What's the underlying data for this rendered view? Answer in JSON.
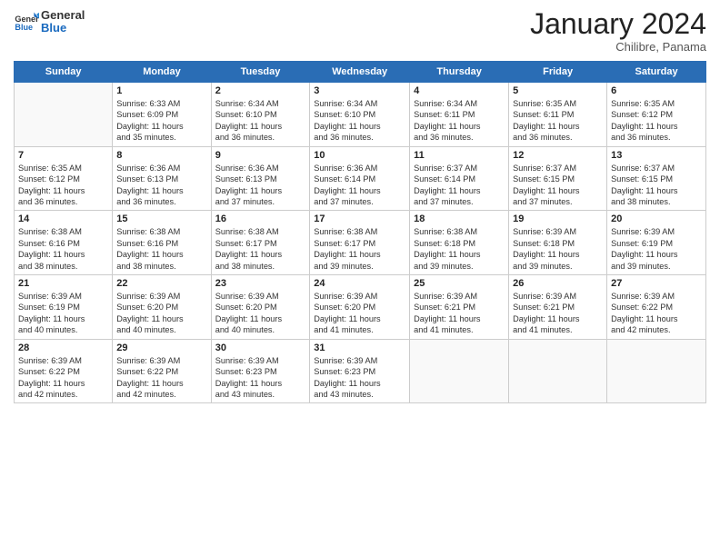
{
  "header": {
    "logo_general": "General",
    "logo_blue": "Blue",
    "month_title": "January 2024",
    "subtitle": "Chilibre, Panama"
  },
  "weekdays": [
    "Sunday",
    "Monday",
    "Tuesday",
    "Wednesday",
    "Thursday",
    "Friday",
    "Saturday"
  ],
  "weeks": [
    [
      {
        "day": "",
        "info": ""
      },
      {
        "day": "1",
        "info": "Sunrise: 6:33 AM\nSunset: 6:09 PM\nDaylight: 11 hours\nand 35 minutes."
      },
      {
        "day": "2",
        "info": "Sunrise: 6:34 AM\nSunset: 6:10 PM\nDaylight: 11 hours\nand 36 minutes."
      },
      {
        "day": "3",
        "info": "Sunrise: 6:34 AM\nSunset: 6:10 PM\nDaylight: 11 hours\nand 36 minutes."
      },
      {
        "day": "4",
        "info": "Sunrise: 6:34 AM\nSunset: 6:11 PM\nDaylight: 11 hours\nand 36 minutes."
      },
      {
        "day": "5",
        "info": "Sunrise: 6:35 AM\nSunset: 6:11 PM\nDaylight: 11 hours\nand 36 minutes."
      },
      {
        "day": "6",
        "info": "Sunrise: 6:35 AM\nSunset: 6:12 PM\nDaylight: 11 hours\nand 36 minutes."
      }
    ],
    [
      {
        "day": "7",
        "info": "Sunrise: 6:35 AM\nSunset: 6:12 PM\nDaylight: 11 hours\nand 36 minutes."
      },
      {
        "day": "8",
        "info": "Sunrise: 6:36 AM\nSunset: 6:13 PM\nDaylight: 11 hours\nand 36 minutes."
      },
      {
        "day": "9",
        "info": "Sunrise: 6:36 AM\nSunset: 6:13 PM\nDaylight: 11 hours\nand 37 minutes."
      },
      {
        "day": "10",
        "info": "Sunrise: 6:36 AM\nSunset: 6:14 PM\nDaylight: 11 hours\nand 37 minutes."
      },
      {
        "day": "11",
        "info": "Sunrise: 6:37 AM\nSunset: 6:14 PM\nDaylight: 11 hours\nand 37 minutes."
      },
      {
        "day": "12",
        "info": "Sunrise: 6:37 AM\nSunset: 6:15 PM\nDaylight: 11 hours\nand 37 minutes."
      },
      {
        "day": "13",
        "info": "Sunrise: 6:37 AM\nSunset: 6:15 PM\nDaylight: 11 hours\nand 38 minutes."
      }
    ],
    [
      {
        "day": "14",
        "info": "Sunrise: 6:38 AM\nSunset: 6:16 PM\nDaylight: 11 hours\nand 38 minutes."
      },
      {
        "day": "15",
        "info": "Sunrise: 6:38 AM\nSunset: 6:16 PM\nDaylight: 11 hours\nand 38 minutes."
      },
      {
        "day": "16",
        "info": "Sunrise: 6:38 AM\nSunset: 6:17 PM\nDaylight: 11 hours\nand 38 minutes."
      },
      {
        "day": "17",
        "info": "Sunrise: 6:38 AM\nSunset: 6:17 PM\nDaylight: 11 hours\nand 39 minutes."
      },
      {
        "day": "18",
        "info": "Sunrise: 6:38 AM\nSunset: 6:18 PM\nDaylight: 11 hours\nand 39 minutes."
      },
      {
        "day": "19",
        "info": "Sunrise: 6:39 AM\nSunset: 6:18 PM\nDaylight: 11 hours\nand 39 minutes."
      },
      {
        "day": "20",
        "info": "Sunrise: 6:39 AM\nSunset: 6:19 PM\nDaylight: 11 hours\nand 39 minutes."
      }
    ],
    [
      {
        "day": "21",
        "info": "Sunrise: 6:39 AM\nSunset: 6:19 PM\nDaylight: 11 hours\nand 40 minutes."
      },
      {
        "day": "22",
        "info": "Sunrise: 6:39 AM\nSunset: 6:20 PM\nDaylight: 11 hours\nand 40 minutes."
      },
      {
        "day": "23",
        "info": "Sunrise: 6:39 AM\nSunset: 6:20 PM\nDaylight: 11 hours\nand 40 minutes."
      },
      {
        "day": "24",
        "info": "Sunrise: 6:39 AM\nSunset: 6:20 PM\nDaylight: 11 hours\nand 41 minutes."
      },
      {
        "day": "25",
        "info": "Sunrise: 6:39 AM\nSunset: 6:21 PM\nDaylight: 11 hours\nand 41 minutes."
      },
      {
        "day": "26",
        "info": "Sunrise: 6:39 AM\nSunset: 6:21 PM\nDaylight: 11 hours\nand 41 minutes."
      },
      {
        "day": "27",
        "info": "Sunrise: 6:39 AM\nSunset: 6:22 PM\nDaylight: 11 hours\nand 42 minutes."
      }
    ],
    [
      {
        "day": "28",
        "info": "Sunrise: 6:39 AM\nSunset: 6:22 PM\nDaylight: 11 hours\nand 42 minutes."
      },
      {
        "day": "29",
        "info": "Sunrise: 6:39 AM\nSunset: 6:22 PM\nDaylight: 11 hours\nand 42 minutes."
      },
      {
        "day": "30",
        "info": "Sunrise: 6:39 AM\nSunset: 6:23 PM\nDaylight: 11 hours\nand 43 minutes."
      },
      {
        "day": "31",
        "info": "Sunrise: 6:39 AM\nSunset: 6:23 PM\nDaylight: 11 hours\nand 43 minutes."
      },
      {
        "day": "",
        "info": ""
      },
      {
        "day": "",
        "info": ""
      },
      {
        "day": "",
        "info": ""
      }
    ]
  ]
}
